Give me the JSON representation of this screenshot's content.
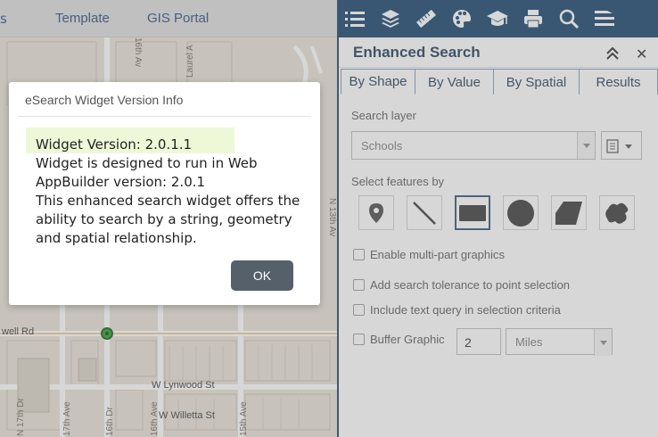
{
  "header": {
    "left_fragment": "s",
    "links": [
      "Template",
      "GIS Portal"
    ]
  },
  "map": {
    "labels": {
      "street_top": "16th Av",
      "laurel": "Laurel A",
      "n13": "N 13th Av",
      "rd": "well Rd",
      "lynwood": "W Lynwood St",
      "n17": "N 17th Dr",
      "ave17": "17th Ave",
      "dr16": "16th Dr",
      "ave16": "16th Ave",
      "ave15": "15th Ave",
      "willetta": "W Willetta St"
    },
    "marker_color": "#1f9e1f"
  },
  "toolbar": {
    "icons": [
      "list-icon",
      "layers-icon",
      "ruler-icon",
      "palette-icon",
      "graduation-icon",
      "print-icon",
      "search-icon",
      "menu-icon"
    ]
  },
  "panel": {
    "title": "Enhanced Search",
    "tabs": [
      "By Shape",
      "By Value",
      "By Spatial",
      "Results"
    ],
    "active_tab": "By Shape",
    "search_layer_label": "Search layer",
    "search_layer_value": "Schools",
    "select_features_label": "Select features by",
    "shapes": [
      "point",
      "line",
      "extent",
      "circle",
      "polygon",
      "freehand"
    ],
    "checkboxes": {
      "multipart": "Enable multi-part graphics",
      "tolerance": "Add search tolerance to point selection",
      "text_query": "Include text query in selection criteria",
      "buffer": "Buffer Graphic"
    },
    "buffer_distance": "2",
    "buffer_units": "Miles"
  },
  "dialog": {
    "title": "eSearch Widget Version Info",
    "line1": "Widget Version: 2.0.1.1",
    "line2": "Widget is designed to run in Web AppBuilder version: 2.0.1",
    "line3": "This enhanced search widget offers the ability to search by a string, geometry and spatial relationship.",
    "ok_label": "OK"
  }
}
